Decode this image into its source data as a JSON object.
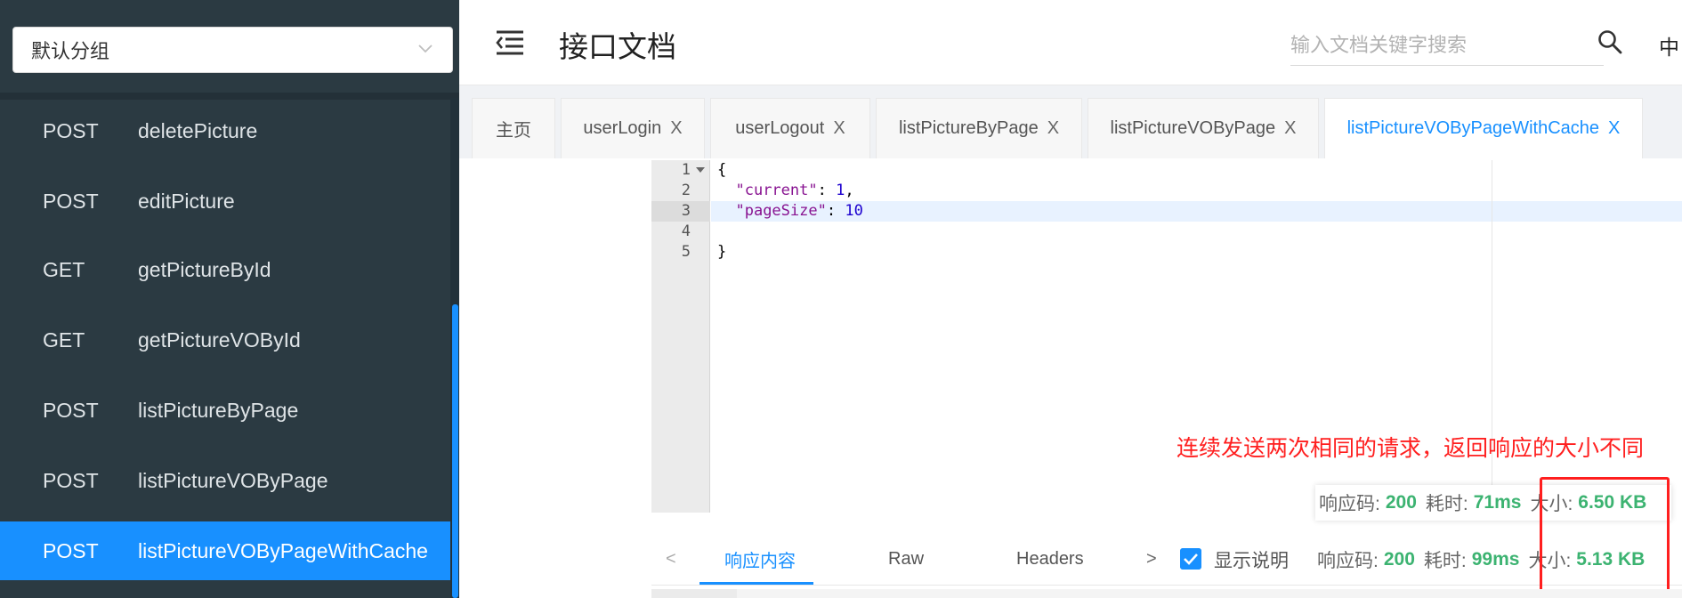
{
  "sidebar": {
    "group_select": "默认分组",
    "items": [
      {
        "method": "POST",
        "path": "deletePicture"
      },
      {
        "method": "POST",
        "path": "editPicture"
      },
      {
        "method": "GET",
        "path": "getPictureById"
      },
      {
        "method": "GET",
        "path": "getPictureVOById"
      },
      {
        "method": "POST",
        "path": "listPictureByPage"
      },
      {
        "method": "POST",
        "path": "listPictureVOByPage"
      },
      {
        "method": "POST",
        "path": "listPictureVOByPageWithCache"
      }
    ]
  },
  "header": {
    "title": "接口文档",
    "search_placeholder": "输入文档关键字搜索",
    "lang": "中"
  },
  "tabs": [
    {
      "label": "主页",
      "closable": false
    },
    {
      "label": "userLogin",
      "closable": true
    },
    {
      "label": "userLogout",
      "closable": true
    },
    {
      "label": "listPictureByPage",
      "closable": true
    },
    {
      "label": "listPictureVOByPage",
      "closable": true
    },
    {
      "label": "listPictureVOByPageWithCache",
      "closable": true
    }
  ],
  "tab_close_glyph": "X",
  "editor": {
    "line_numbers": [
      "1",
      "2",
      "3",
      "4",
      "5"
    ],
    "brace_open": "{",
    "key_current": "\"current\"",
    "val_current": "1",
    "key_page_size": "\"pageSize\"",
    "val_page_size": "10",
    "brace_close": "}"
  },
  "annotation": "连续发送两次相同的请求，返回响应的大小不同",
  "status_first": {
    "code_label": "响应码:",
    "code": "200",
    "time_label": "耗时:",
    "time": "71ms",
    "size_label": "大小:",
    "size": "6.50 KB"
  },
  "response_bar": {
    "prev_glyph": "<",
    "tabs": [
      "响应内容",
      "Raw",
      "Headers"
    ],
    "next_glyph": ">",
    "show_desc": "显示说明"
  },
  "status_second": {
    "code_label": "响应码:",
    "code": "200",
    "time_label": "耗时:",
    "time": "99ms",
    "size_label": "大小:",
    "size": "5.13 KB"
  },
  "colors": {
    "accent": "#1890ff",
    "sidebar_bg": "#2b3a42",
    "annotation_red": "#ff1f1f",
    "status_green": "#3cb371"
  }
}
